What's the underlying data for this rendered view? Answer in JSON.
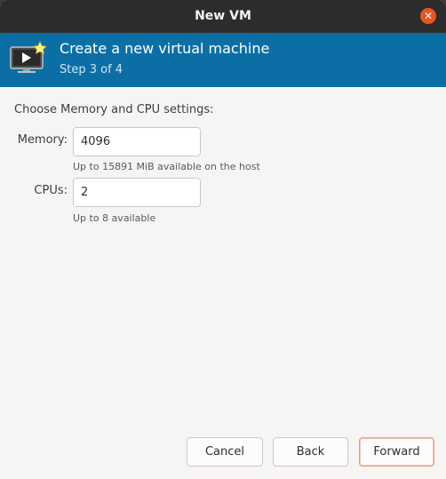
{
  "window": {
    "title": "New VM",
    "close_icon": "close-icon",
    "colors": {
      "titlebar": "#2c2c2c",
      "close": "#e95420",
      "header": "#0b6fa6"
    }
  },
  "header": {
    "icon": "vm-monitor-icon",
    "title": "Create a new virtual machine",
    "step": "Step 3 of 4"
  },
  "settings": {
    "section_label": "Choose Memory and CPU settings:",
    "memory": {
      "label": "Memory:",
      "value": "4096",
      "decrement": "−",
      "increment": "+",
      "hint": "Up to 15891 MiB available on the host"
    },
    "cpus": {
      "label": "CPUs:",
      "value": "2",
      "decrement": "−",
      "increment": "+",
      "hint": "Up to 8 available"
    }
  },
  "buttons": {
    "cancel": "Cancel",
    "back": "Back",
    "forward": "Forward"
  }
}
